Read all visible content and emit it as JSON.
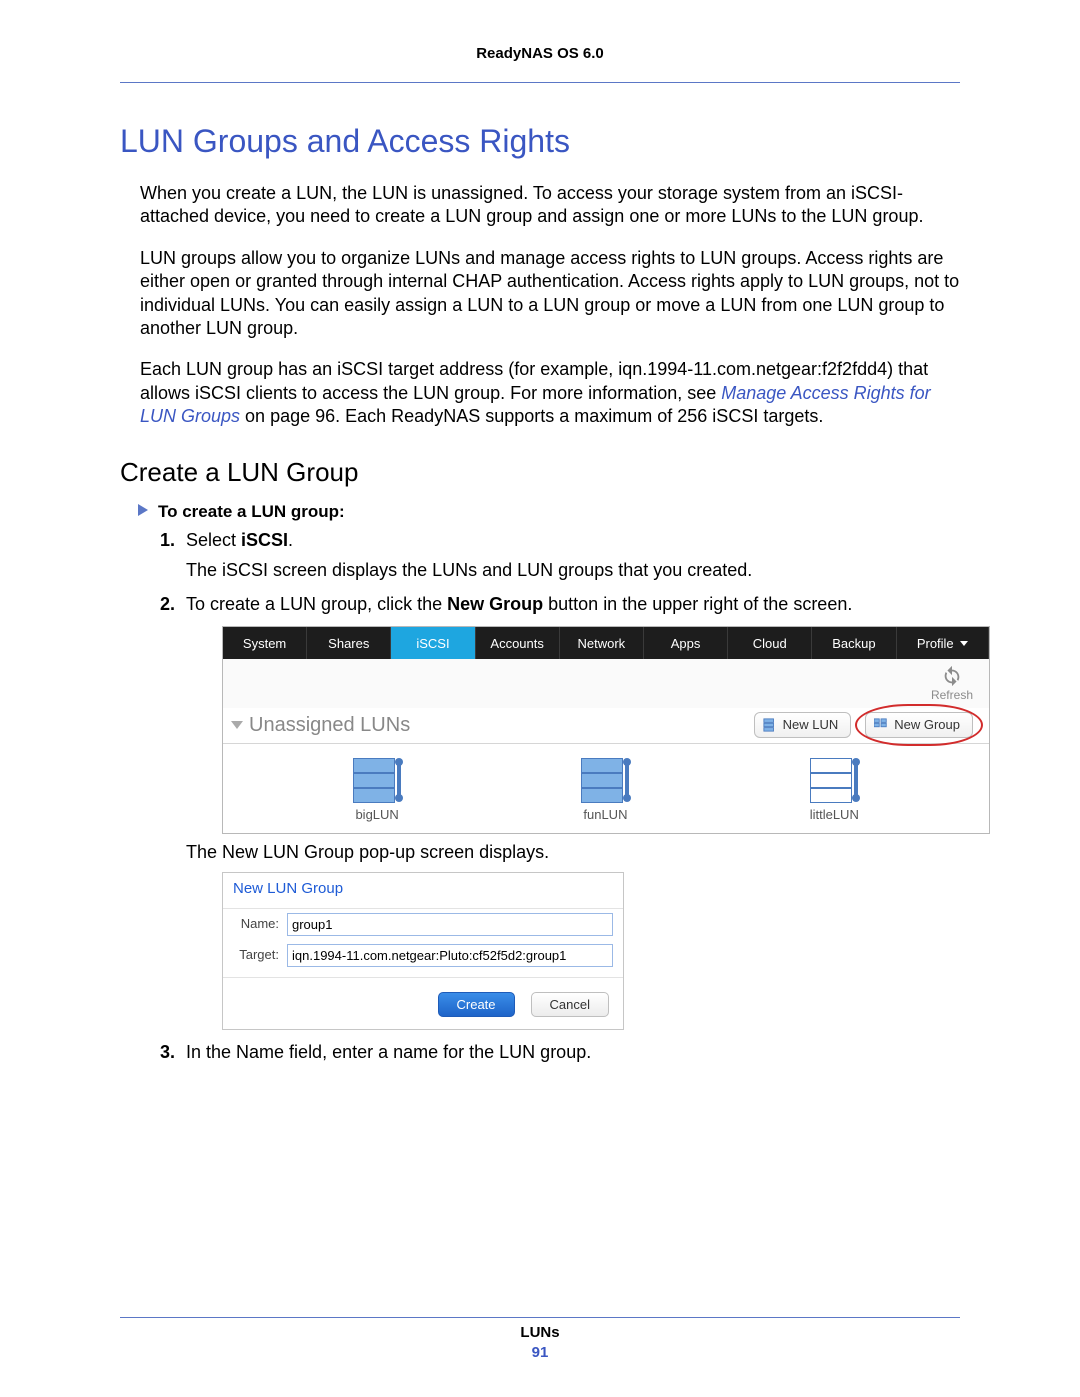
{
  "running_head": "ReadyNAS OS 6.0",
  "h1": "LUN Groups and Access Rights",
  "para1": "When you create a LUN, the LUN is unassigned. To access your storage system from an iSCSI-attached device, you need to create a LUN group and assign one or more LUNs to the LUN group.",
  "para2": "LUN groups allow you to organize LUNs and manage access rights to LUN groups. Access rights are either open or granted through internal CHAP authentication. Access rights apply to LUN groups, not to individual LUNs. You can easily assign a LUN to a LUN group or move a LUN from one LUN group to another LUN group.",
  "para3a": "Each LUN group has an iSCSI target address (for example, iqn.1994-11.com.netgear:f2f2fdd4) that allows iSCSI clients to access the LUN group. For more information, see ",
  "para3_link": "Manage Access Rights for LUN Groups",
  "para3b": " on page 96. Each ReadyNAS supports a maximum of 256 iSCSI targets.",
  "h2": "Create a LUN Group",
  "proc_title": "To create a LUN group:",
  "step1_pre": "Select ",
  "step1_bold": "iSCSI",
  "step1_post": ".",
  "step1_sub": "The iSCSI screen displays the LUNs and LUN groups that you created.",
  "step2_pre": "To create a LUN group, click the ",
  "step2_bold": "New Group",
  "step2_post": " button in the upper right of the screen.",
  "step2_sub": "The New LUN Group pop-up screen displays.",
  "step3": "In the Name field, enter a name for the LUN group.",
  "shot1": {
    "tabs": [
      "System",
      "Shares",
      "iSCSI",
      "Accounts",
      "Network",
      "Apps",
      "Cloud",
      "Backup",
      "Profile"
    ],
    "active_tab": "iSCSI",
    "refresh": "Refresh",
    "section": "Unassigned LUNs",
    "new_lun": "New LUN",
    "new_group": "New Group",
    "luns": [
      "bigLUN",
      "funLUN",
      "littleLUN"
    ]
  },
  "shot2": {
    "title": "New LUN Group",
    "name_label": "Name:",
    "name_value": "group1",
    "target_label": "Target:",
    "target_value": "iqn.1994-11.com.netgear:Pluto:cf52f5d2:group1",
    "create": "Create",
    "cancel": "Cancel"
  },
  "footer_label": "LUNs",
  "page_number": "91"
}
